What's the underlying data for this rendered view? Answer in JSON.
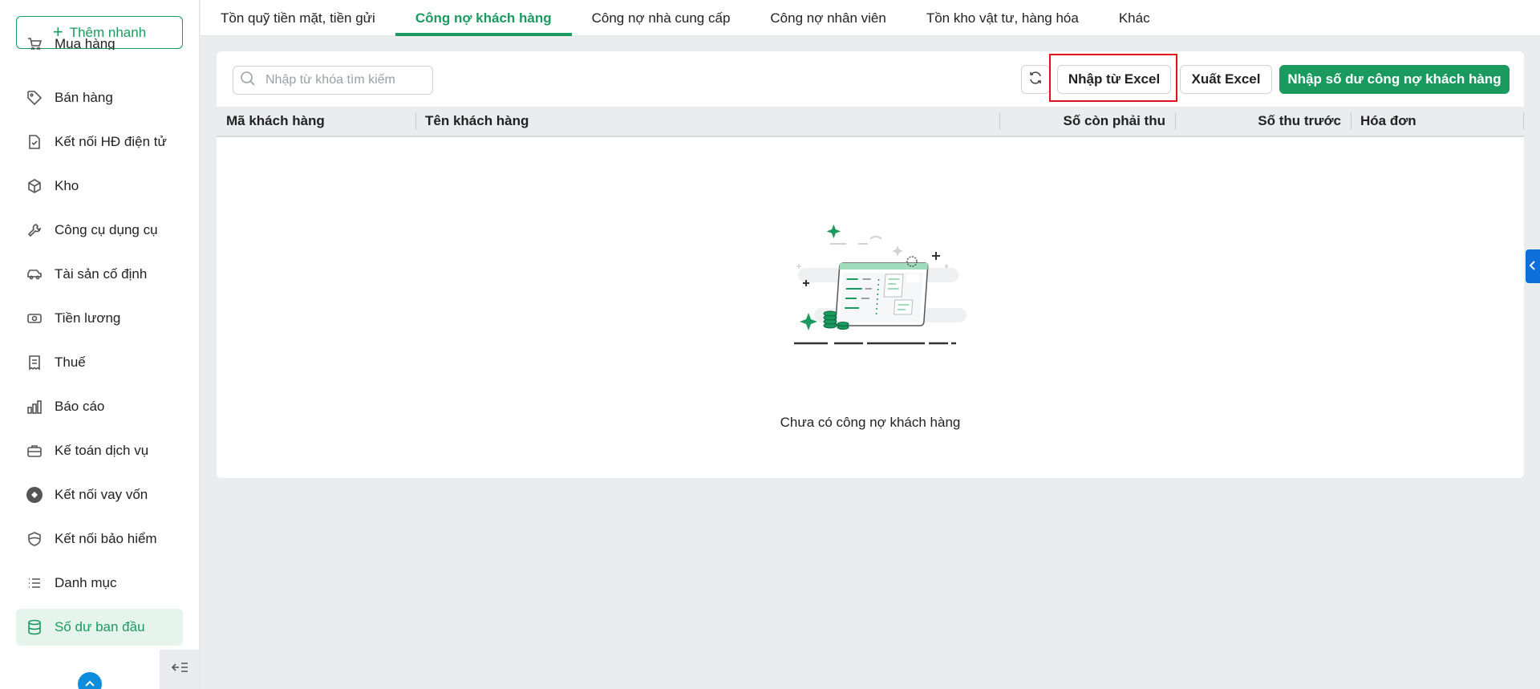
{
  "sidebar": {
    "quick_add": {
      "icon": "plus-icon",
      "label": "Thêm nhanh"
    },
    "items": [
      {
        "icon": "cart-icon",
        "label": "Mua hàng"
      },
      {
        "icon": "tag-icon",
        "label": "Bán hàng"
      },
      {
        "icon": "e-invoice-icon",
        "label": "Kết nối HĐ điện tử"
      },
      {
        "icon": "box-icon",
        "label": "Kho"
      },
      {
        "icon": "tools-icon",
        "label": "Công cụ dụng cụ"
      },
      {
        "icon": "car-icon",
        "label": "Tài sản cố định"
      },
      {
        "icon": "money-icon",
        "label": "Tiền lương"
      },
      {
        "icon": "receipt-icon",
        "label": "Thuế"
      },
      {
        "icon": "bar-chart-icon",
        "label": "Báo cáo"
      },
      {
        "icon": "briefcase-icon",
        "label": "Kế toán dịch vụ"
      },
      {
        "icon": "loan-icon",
        "label": "Kết nối vay vốn"
      },
      {
        "icon": "shield-icon",
        "label": "Kết nối bảo hiểm"
      },
      {
        "icon": "list-icon",
        "label": "Danh mục"
      },
      {
        "icon": "database-icon",
        "label": "Số dư ban đầu",
        "active": true
      }
    ]
  },
  "tabs": [
    {
      "label": "Tồn quỹ tiền mặt, tiền gửi"
    },
    {
      "label": "Công nợ khách hàng",
      "active": true
    },
    {
      "label": "Công nợ nhà cung cấp"
    },
    {
      "label": "Công nợ nhân viên"
    },
    {
      "label": "Tồn kho vật tư, hàng hóa"
    },
    {
      "label": "Khác"
    }
  ],
  "toolbar": {
    "search_placeholder": "Nhập từ khóa tìm kiếm",
    "search_value": "",
    "import_label": "Nhập từ Excel",
    "export_label": "Xuất Excel",
    "primary_label": "Nhập số dư công nợ khách hàng"
  },
  "table": {
    "columns": [
      "Mã khách hàng",
      "Tên khách hàng",
      "Số còn phải thu",
      "Số thu trước",
      "Hóa đơn"
    ],
    "rows": []
  },
  "empty_state": {
    "text": "Chưa có công nợ khách hàng"
  },
  "colors": {
    "accent": "#1a9a5e",
    "highlight": "#e0121b",
    "side_handle": "#0d6fd9"
  }
}
